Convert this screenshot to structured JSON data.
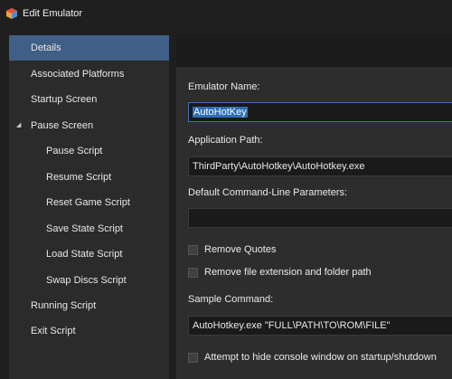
{
  "window": {
    "title": "Edit Emulator",
    "icon": "launchbox-logo-icon"
  },
  "sidebar": {
    "items": [
      {
        "label": "Details",
        "selected": true
      },
      {
        "label": "Associated Platforms"
      },
      {
        "label": "Startup Screen"
      },
      {
        "label": "Pause Screen",
        "expanded": true
      },
      {
        "label": "Pause Script"
      },
      {
        "label": "Resume Script"
      },
      {
        "label": "Reset Game Script"
      },
      {
        "label": "Save State Script"
      },
      {
        "label": "Load State Script"
      },
      {
        "label": "Swap Discs Script"
      },
      {
        "label": "Running Script"
      },
      {
        "label": "Exit Script"
      }
    ]
  },
  "form": {
    "emulator_name_label": "Emulator Name:",
    "emulator_name_value": "AutoHotKey",
    "app_path_label": "Application Path:",
    "app_path_value": "ThirdParty\\AutoHotkey\\AutoHotkey.exe",
    "cmdline_label": "Default Command-Line Parameters:",
    "cmdline_value": "",
    "remove_quotes_label": "Remove Quotes",
    "remove_ext_label": "Remove file extension and folder path",
    "sample_cmd_label": "Sample Command:",
    "sample_cmd_value": "AutoHotkey.exe \"FULL\\PATH\\TO\\ROM\\FILE\"",
    "hide_console_label": "Attempt to hide console window on startup/shutdown"
  },
  "colors": {
    "accent": "#3f5f86",
    "selection": "#2f6db5",
    "background": "#1f1f1f"
  }
}
